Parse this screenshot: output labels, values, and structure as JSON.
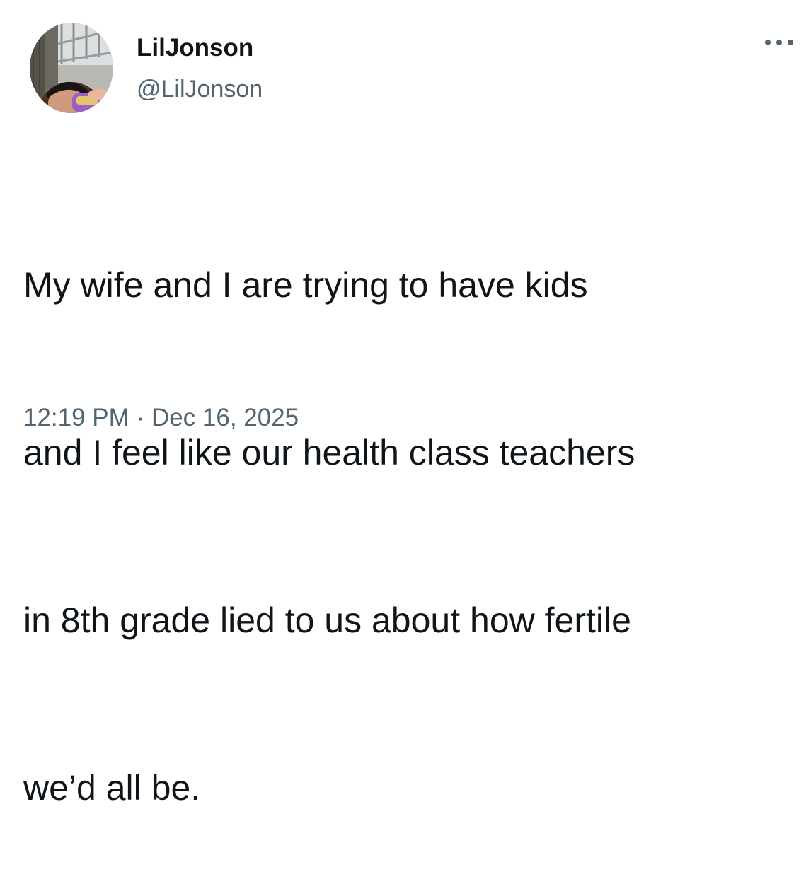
{
  "author": {
    "display_name": "LilJonson",
    "handle": "@LilJonson",
    "avatar": "profile-photo"
  },
  "menu_icon": "more-options-icon",
  "tweet": {
    "lines": [
      "My wife and I are trying to have kids",
      "and I feel like our health class teachers",
      "in 8th grade lied to us about how fertile",
      "we’d all be."
    ]
  },
  "meta": {
    "time": "12:19 PM",
    "separator": "·",
    "date": "Dec 16, 2025"
  },
  "colors": {
    "text_primary": "#0f1419",
    "text_secondary": "#536471",
    "background": "#ffffff"
  }
}
